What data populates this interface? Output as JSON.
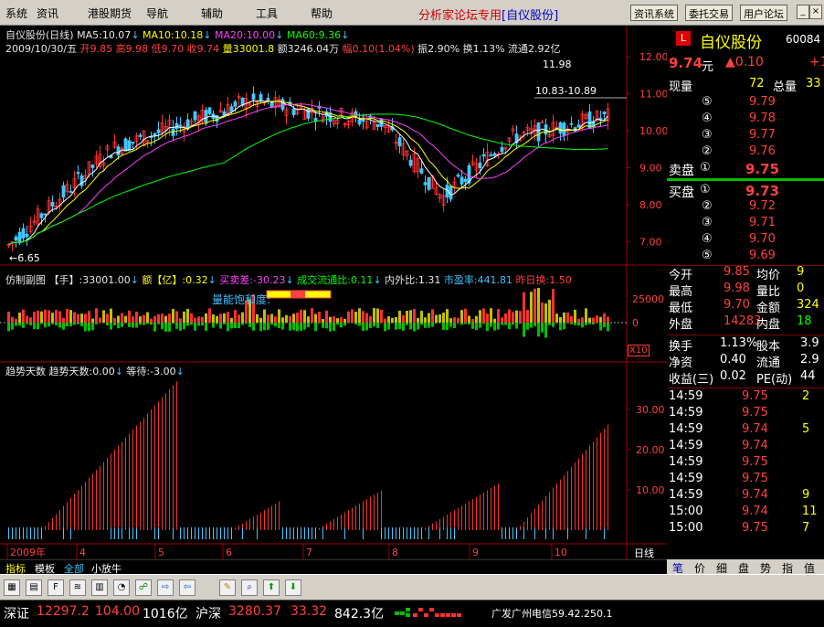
{
  "menu": {
    "items": [
      "系统",
      "资讯",
      "港股期货",
      "导航",
      "辅助",
      "工具",
      "帮助"
    ],
    "promo": "分析家论坛专用",
    "promo_stock": "[自仪股份]",
    "buttons": [
      "资讯系统",
      "委托交易",
      "用户论坛"
    ]
  },
  "stock": {
    "name": "自仪股份",
    "code": "60084",
    "flag": "L"
  },
  "chart_header": {
    "title": "自仪股份(日线)",
    "ma5": "MA5:10.07",
    "ma10": "MA10:10.18",
    "ma20": "MA20:10.00",
    "ma60": "MA60:9.36",
    "line2_date": "2009/10/30/五",
    "open": "开9.85",
    "high": "高9.98",
    "low": "低9.70",
    "close": "收9.74",
    "vol": "量33001.8",
    "amount": "额3246.04万",
    "change": "幅0.10(1.04%)",
    "amp": "振2.90%",
    "turnover": "换1.13%",
    "float": "流通2.92亿"
  },
  "price_axis": {
    "ticks": [
      "12.00",
      "11.00",
      "10.00",
      "9.00",
      "8.00",
      "7.00"
    ]
  },
  "annotations": {
    "high": "11.98",
    "range": "10.83-10.89",
    "low": "6.65"
  },
  "sub1": {
    "title": "仿制副图",
    "hand": "【手】:33001.00",
    "amt": "额【亿】:0.32",
    "buysell": "买卖差:-30.23",
    "ratio": "成交流通比:0.11",
    "inout": "内外比:1.31",
    "pe": "市盈率:441.81",
    "yest": "昨日换:1.50",
    "label": "量能饱和度:",
    "ticks": [
      "25000",
      "0"
    ],
    "x10": "X10"
  },
  "sub2": {
    "title": "趋势天数",
    "value": "趋势天数:0.00",
    "wait": "等待:-3.00",
    "ticks": [
      "30.00",
      "20.00",
      "10.00"
    ]
  },
  "xaxis": {
    "labels": [
      "2009年",
      "4",
      "5",
      "6",
      "7",
      "8",
      "9",
      "10"
    ],
    "period": "日线"
  },
  "quote": {
    "price": "9.74",
    "unit": "元",
    "change": "0.10",
    "plus": "+1",
    "cur_vol_label": "现量",
    "cur_vol": "72",
    "total_label": "总量",
    "total": "33",
    "sell": [
      {
        "n": "⑤",
        "p": "9.79"
      },
      {
        "n": "④",
        "p": "9.78"
      },
      {
        "n": "③",
        "p": "9.77"
      },
      {
        "n": "②",
        "p": "9.76"
      }
    ],
    "sell1_label": "卖盘",
    "sell1_n": "①",
    "sell1": "9.75",
    "buy1_label": "买盘",
    "buy1_n": "①",
    "buy1": "9.73",
    "buy": [
      {
        "n": "②",
        "p": "9.72"
      },
      {
        "n": "③",
        "p": "9.71"
      },
      {
        "n": "④",
        "p": "9.70"
      },
      {
        "n": "⑤",
        "p": "9.69"
      }
    ],
    "stats": [
      {
        "l": "今开",
        "v": "9.85",
        "l2": "均价",
        "v2": "9"
      },
      {
        "l": "最高",
        "v": "9.98",
        "l2": "量比",
        "v2": "0"
      },
      {
        "l": "最低",
        "v": "9.70",
        "l2": "金额",
        "v2": "324"
      },
      {
        "l": "外盘",
        "v": "14283",
        "l2": "内盘",
        "v2": "18"
      }
    ],
    "stats2": [
      {
        "l": "换手",
        "v": "1.13%",
        "l2": "股本",
        "v2": "3.9"
      },
      {
        "l": "净资",
        "v": "0.40",
        "l2": "流通",
        "v2": "2.9"
      },
      {
        "l": "收益(三)",
        "v": "0.02",
        "l2": "PE(动)",
        "v2": "44"
      }
    ],
    "ticks": [
      {
        "t": "14:59",
        "p": "9.75",
        "v": "2"
      },
      {
        "t": "14:59",
        "p": "9.75",
        "v": ""
      },
      {
        "t": "14:59",
        "p": "9.74",
        "v": "5"
      },
      {
        "t": "14:59",
        "p": "9.74",
        "v": ""
      },
      {
        "t": "14:59",
        "p": "9.75",
        "v": ""
      },
      {
        "t": "14:59",
        "p": "9.75",
        "v": ""
      },
      {
        "t": "14:59",
        "p": "9.74",
        "v": "9"
      },
      {
        "t": "15:00",
        "p": "9.74",
        "v": "11"
      },
      {
        "t": "15:00",
        "p": "9.75",
        "v": "7"
      }
    ]
  },
  "bottom_tabs": [
    "指标",
    "模板",
    "全部",
    "小放牛"
  ],
  "quote_tabs": [
    "笔",
    "价",
    "细",
    "盘",
    "势",
    "指",
    "值"
  ],
  "toolbar": {
    "icons": [
      "grid-icon",
      "minute-icon",
      "f10-icon",
      "chart-icon",
      "bar-icon",
      "pie-icon",
      "link-icon",
      "export-icon",
      "pen-icon",
      "zoom-icon",
      "up-arrow-icon",
      "down-arrow-icon"
    ]
  },
  "status": {
    "sz_label": "深证",
    "sz": "12297.2",
    "sz_chg": "104.00",
    "sz_amt": "1016亿",
    "hs_label": "沪深",
    "hs": "3280.37",
    "hs_chg": "33.32",
    "hs_amt": "842.3亿",
    "server": "广发广州电信59.42.250.1"
  }
}
